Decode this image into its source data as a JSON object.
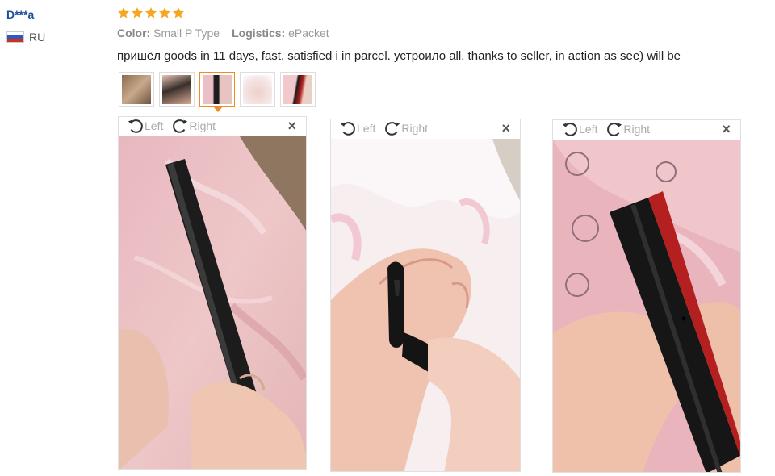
{
  "review": {
    "reviewer": "D***a",
    "country": "RU",
    "rating": 5,
    "color_label": "Color:",
    "color_value": "Small P Type",
    "logistics_label": "Logistics:",
    "logistics_value": "ePacket",
    "comment": "пришёл goods in 11 days, fast, satisfied i in parcel. устроило all, thanks to seller, in action as see) will be"
  },
  "thumbnails": [
    {
      "selected": false
    },
    {
      "selected": false
    },
    {
      "selected": true
    },
    {
      "selected": false
    },
    {
      "selected": false
    }
  ],
  "viewers": [
    {
      "left_label": "Left",
      "right_label": "Right",
      "close_label": "×"
    },
    {
      "left_label": "Left",
      "right_label": "Right",
      "close_label": "×"
    },
    {
      "left_label": "Left",
      "right_label": "Right",
      "close_label": "×"
    }
  ],
  "colors": {
    "reviewer": "#1e4e9e",
    "star": "#f5a623",
    "selected_thumb_border": "#f08a24",
    "flag_white": "#ffffff",
    "flag_blue": "#2a5cbf",
    "flag_red": "#d52b1e"
  },
  "icons": {
    "rotate_left": "rotate-left-icon",
    "rotate_right": "rotate-right-icon",
    "close": "close-icon",
    "star": "star-icon",
    "flag": "flag-ru-icon"
  }
}
